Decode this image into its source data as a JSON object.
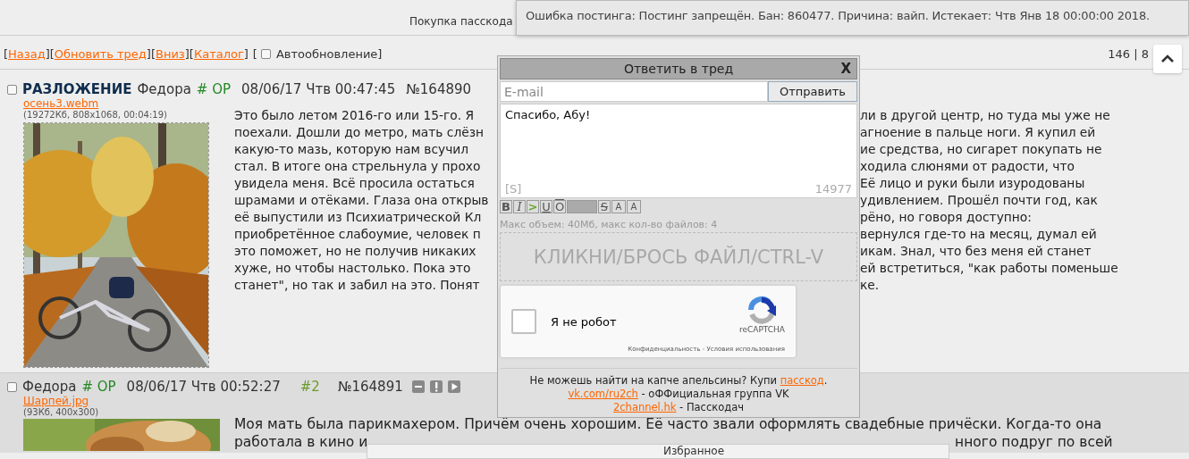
{
  "top_notice": {
    "text": "Покупка пасскода"
  },
  "error_toast": {
    "text": "Ошибка постинга: Постинг запрещён. Бан: 860477. Причина: вайп. Истекает: Чтв Янв 18 00:00:00 2018."
  },
  "nav": {
    "bracket_open": "[",
    "bracket_close": "]",
    "links": [
      "Назад",
      "Обновить тред",
      "Вниз",
      "Каталог"
    ],
    "autoupdate": {
      "label": "Автообновление",
      "checked": false
    },
    "counter": "146 | 8"
  },
  "posts": [
    {
      "kind": "op",
      "checked": false,
      "subject": "РАЗЛОЖЕНИЕ",
      "name": "Федора",
      "tripcode": "# OP",
      "date": "08/06/17 Чтв 00:47:45",
      "number": "№164890",
      "file": {
        "name": "осень3.webm",
        "meta": "(19272Кб, 808x1068, 00:04:19)"
      },
      "lines": [
        {
          "left": "Это было летом 2016-го или 15-го. Я",
          "right": "ли в другой центр, но туда мы уже не"
        },
        {
          "left": "поехали. Дошли до метро, мать слёзн",
          "right": "агноение в пальце ноги. Я купил ей"
        },
        {
          "left": "какую-то мазь, которую нам всучил",
          "right": "ие средства, но сигарет покупать не"
        },
        {
          "left": "стал. В итоге она стрельнула у прохо",
          "right": "ходила слюнями от радости, что"
        },
        {
          "left": "увидела меня. Всё просила остаться",
          "right": "Её лицо и руки были изуродованы"
        },
        {
          "left": "шрамами и отёками. Глаза она открыв",
          "right": "удивлением. Прошёл почти год, как"
        },
        {
          "left": "её выпустили из Психиатрической Кл",
          "right": "рёно, но говоря доступно:"
        },
        {
          "left": "приобретённое слабоумие, человек п",
          "right": "вернулся где-то на месяц, думал ей"
        },
        {
          "left": "это поможет, но не получив никаких",
          "right": "икам. Знал, что без меня ей станет"
        },
        {
          "left": "хуже, но чтобы настолько. Пока это",
          "right": "ей встретиться, \"как работы поменьше"
        },
        {
          "left": "станет\", но так и забил на это. Понят",
          "right": "ке."
        }
      ]
    },
    {
      "kind": "reply",
      "checked": false,
      "name": "Федора",
      "tripcode": "# OP",
      "date": "08/06/17 Чтв 00:52:27",
      "index": "#2",
      "number": "№164891",
      "actions": [
        {
          "kind": "hide"
        },
        {
          "kind": "report"
        },
        {
          "kind": "play"
        }
      ],
      "file": {
        "name": "Шарпей.jpg",
        "meta": "(93Кб, 400x300)"
      },
      "lines": [
        {
          "left": "Моя мать была парикмахером. Причём очень хорошим. Её часто звали оформлять свадебные причёски. Когда-то она"
        },
        {
          "left": "работала в кино и",
          "right": "нного подруг по всей"
        }
      ]
    }
  ],
  "reply_form": {
    "title": "Ответить в тред",
    "close": "X",
    "email_placeholder": "E-mail",
    "submit": "Отправить",
    "message": "Спасибо, Абу!",
    "sage": "[S]",
    "chars_left": "14977",
    "markup_buttons": [
      {
        "kind": "bold",
        "label": "B"
      },
      {
        "kind": "italic",
        "label": "I"
      },
      {
        "kind": "quote",
        "label": ">"
      },
      {
        "kind": "underline",
        "label": "U"
      },
      {
        "kind": "overline",
        "label": "O"
      },
      {
        "kind": "spoiler"
      },
      {
        "kind": "strike",
        "label": "S"
      },
      {
        "kind": "sup",
        "label": "A"
      },
      {
        "kind": "sub",
        "label": "A"
      }
    ],
    "limits": "Макс объем: 40Мб, макс кол-во файлов: 4",
    "dropzone": "КЛИКНИ/БРОСЬ ФАЙЛ/CTRL-V",
    "captcha": {
      "label": "Я не робот",
      "checked": false,
      "brand": "reCAPTCHA",
      "terms": "Конфиденциальность - Условия использования"
    },
    "footer": [
      [
        {
          "kind": "text",
          "text": "Не можешь найти на капче апельсины? Купи "
        },
        {
          "kind": "link",
          "text": "пасскод"
        },
        {
          "kind": "text",
          "text": "."
        }
      ],
      [
        {
          "kind": "link",
          "text": "vk.com/ru2ch"
        },
        {
          "kind": "text",
          "text": " - оФФициальная группа VK"
        }
      ],
      [
        {
          "kind": "link",
          "text": "2channel.hk"
        },
        {
          "kind": "text",
          "text": " - Пасскодач"
        }
      ]
    ]
  },
  "favorites": {
    "title": "Избранное"
  }
}
